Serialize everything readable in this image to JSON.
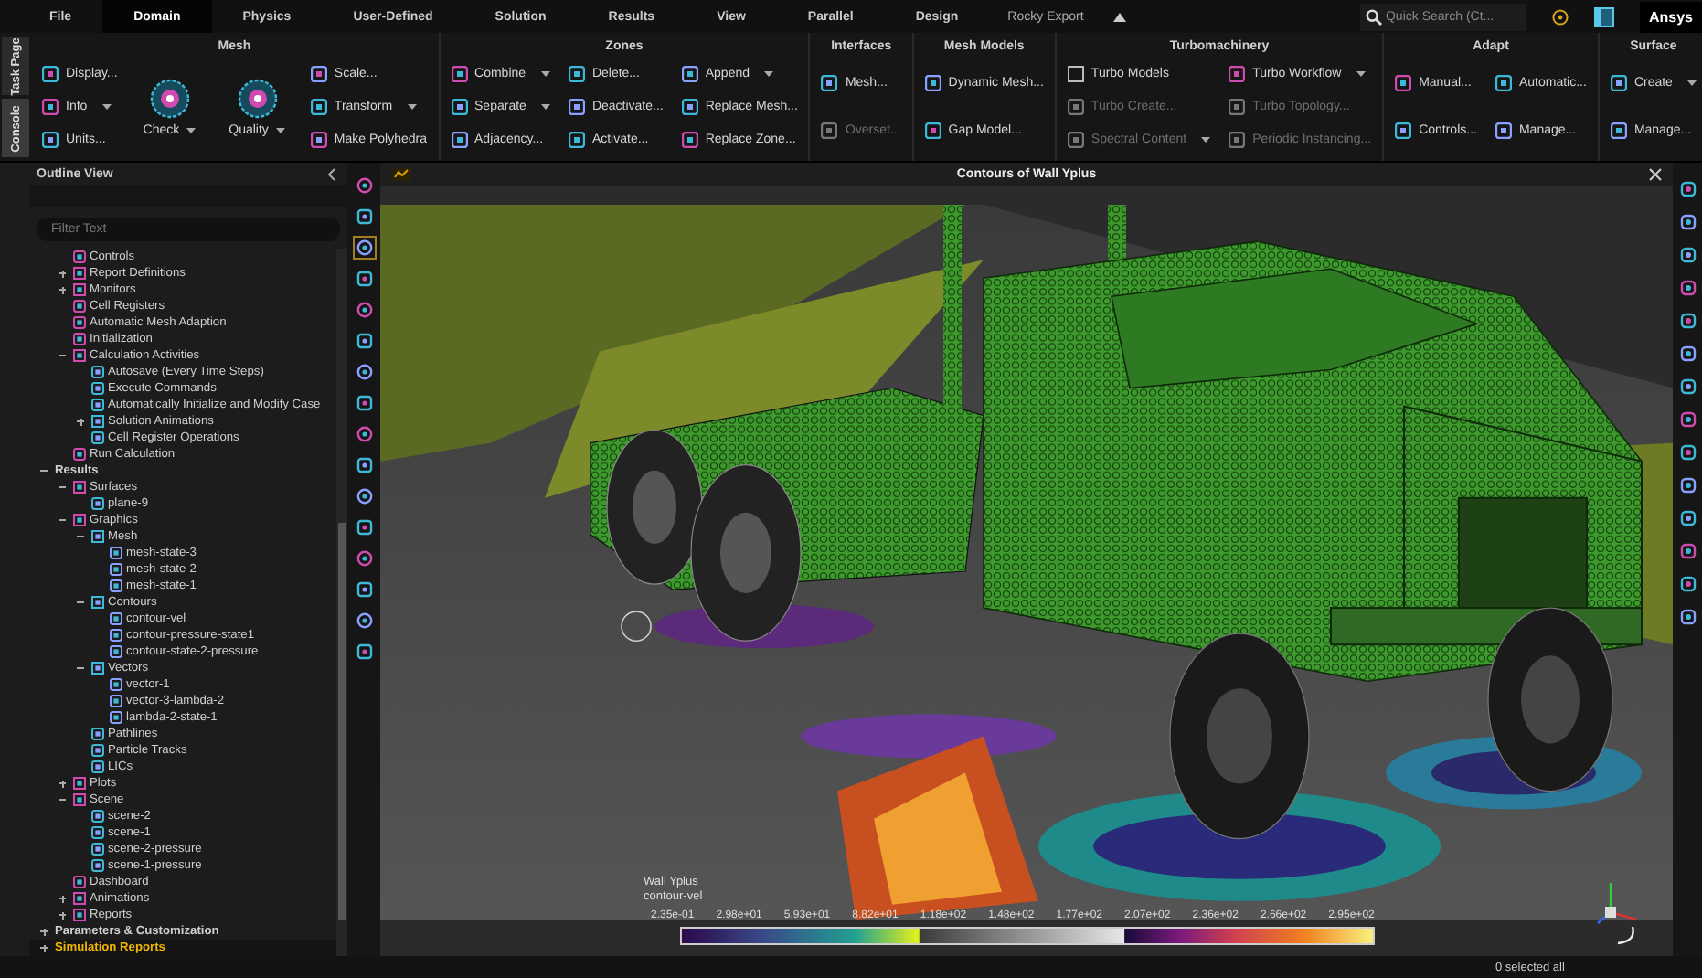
{
  "menu_tabs": [
    {
      "label": "File",
      "selected": false,
      "kind": "tab"
    },
    {
      "label": "Domain",
      "selected": true,
      "kind": "tab"
    },
    {
      "label": "Physics",
      "selected": false,
      "kind": "tab"
    },
    {
      "label": "User-Defined",
      "selected": false,
      "kind": "tab"
    },
    {
      "label": "Solution",
      "selected": false,
      "kind": "tab"
    },
    {
      "label": "Results",
      "selected": false,
      "kind": "tab"
    },
    {
      "label": "View",
      "selected": false,
      "kind": "tab"
    },
    {
      "label": "Parallel",
      "selected": false,
      "kind": "tab"
    },
    {
      "label": "Design",
      "selected": false,
      "kind": "tab"
    },
    {
      "label": "Rocky Export",
      "selected": false,
      "kind": "context"
    }
  ],
  "quick_search": {
    "placeholder": "Quick Search (Ct..."
  },
  "logo": "Ansys",
  "side_tabs": [
    {
      "label": "Task Page",
      "selected": false
    },
    {
      "label": "Console",
      "selected": true
    }
  ],
  "ribbon": {
    "groups": [
      {
        "title": "Mesh",
        "columns": [
          [
            {
              "label": "Display...",
              "kind": "small"
            },
            {
              "label": "Info",
              "kind": "small",
              "dropdown": true
            },
            {
              "label": "Units...",
              "kind": "small"
            }
          ],
          [
            {
              "label": "Check",
              "kind": "large",
              "dropdown": true
            }
          ],
          [
            {
              "label": "Quality",
              "kind": "large",
              "dropdown": true
            }
          ],
          [
            {
              "label": "Scale...",
              "kind": "small"
            },
            {
              "label": "Transform",
              "kind": "small",
              "dropdown": true
            },
            {
              "label": "Make Polyhedra",
              "kind": "small"
            }
          ]
        ]
      },
      {
        "title": "Zones",
        "columns": [
          [
            {
              "label": "Combine",
              "kind": "small",
              "dropdown": true
            },
            {
              "label": "Separate",
              "kind": "small",
              "dropdown": true
            },
            {
              "label": "Adjacency...",
              "kind": "small"
            }
          ],
          [
            {
              "label": "Delete...",
              "kind": "small"
            },
            {
              "label": "Deactivate...",
              "kind": "small"
            },
            {
              "label": "Activate...",
              "kind": "small"
            }
          ],
          [
            {
              "label": "Append",
              "kind": "small",
              "dropdown": true
            },
            {
              "label": "Replace Mesh...",
              "kind": "small"
            },
            {
              "label": "Replace Zone...",
              "kind": "small"
            }
          ]
        ]
      },
      {
        "title": "Interfaces",
        "columns": [
          [
            {
              "label": "Mesh...",
              "kind": "small"
            },
            {
              "label": "Overset...",
              "kind": "small",
              "disabled": true
            }
          ]
        ]
      },
      {
        "title": "Mesh Models",
        "columns": [
          [
            {
              "label": "Dynamic Mesh...",
              "kind": "small"
            },
            {
              "label": "Gap Model...",
              "kind": "small"
            }
          ]
        ]
      },
      {
        "title": "Turbomachinery",
        "columns": [
          [
            {
              "label": "Turbo Models",
              "kind": "checkbox",
              "checked": false
            },
            {
              "label": "Turbo Create...",
              "kind": "small",
              "disabled": true
            },
            {
              "label": "Spectral Content",
              "kind": "small",
              "disabled": true,
              "dropdown": true
            }
          ],
          [
            {
              "label": "Turbo Workflow",
              "kind": "small",
              "dropdown": true
            },
            {
              "label": "Turbo Topology...",
              "kind": "small",
              "disabled": true
            },
            {
              "label": "Periodic Instancing...",
              "kind": "small",
              "disabled": true
            }
          ]
        ]
      },
      {
        "title": "Adapt",
        "columns": [
          [
            {
              "label": "Manual...",
              "kind": "small"
            },
            {
              "label": "Controls...",
              "kind": "small"
            }
          ],
          [
            {
              "label": "Automatic...",
              "kind": "small"
            },
            {
              "label": "Manage...",
              "kind": "small"
            }
          ]
        ]
      },
      {
        "title": "Surface",
        "columns": [
          [
            {
              "label": "Create",
              "kind": "small",
              "dropdown": true
            },
            {
              "label": "Manage...",
              "kind": "small"
            }
          ]
        ]
      }
    ]
  },
  "outline": {
    "title": "Outline View",
    "filter": {
      "placeholder": "Filter Text"
    },
    "continued_items": [
      {
        "label": "Controls",
        "kind": "leaf",
        "selected": false
      },
      {
        "label": "Report Definitions",
        "kind": "folder",
        "expanded": false,
        "selected": false
      },
      {
        "label": "Monitors",
        "kind": "folder",
        "expanded": false,
        "selected": false
      },
      {
        "label": "Cell Registers",
        "kind": "leaf",
        "selected": false
      },
      {
        "label": "Automatic Mesh Adaption",
        "kind": "leaf",
        "selected": false
      },
      {
        "label": "Initialization",
        "kind": "leaf",
        "selected": false
      },
      {
        "label": "Calculation Activities",
        "kind": "folder",
        "expanded": true,
        "selected": false,
        "children": [
          {
            "label": "Autosave (Every Time Steps)",
            "kind": "leaf",
            "selected": false
          },
          {
            "label": "Execute Commands",
            "kind": "leaf",
            "selected": false
          },
          {
            "label": "Automatically Initialize and Modify Case",
            "kind": "leaf",
            "selected": false
          },
          {
            "label": "Solution Animations",
            "kind": "folder",
            "expanded": false,
            "selected": false
          },
          {
            "label": "Cell Register Operations",
            "kind": "leaf",
            "selected": false
          }
        ]
      },
      {
        "label": "Run Calculation",
        "kind": "leaf",
        "selected": false
      }
    ],
    "sections": [
      {
        "label": "Results",
        "kind": "folder",
        "expanded": true,
        "selected": false,
        "children": [
          {
            "label": "Surfaces",
            "kind": "folder",
            "expanded": true,
            "selected": false,
            "children": [
              {
                "label": "plane-9",
                "kind": "leaf",
                "selected": false
              }
            ]
          },
          {
            "label": "Graphics",
            "kind": "folder",
            "expanded": true,
            "selected": false,
            "children": [
              {
                "label": "Mesh",
                "kind": "folder",
                "expanded": true,
                "selected": false,
                "children": [
                  {
                    "label": "mesh-state-3",
                    "kind": "leaf",
                    "selected": false
                  },
                  {
                    "label": "mesh-state-2",
                    "kind": "leaf",
                    "selected": false
                  },
                  {
                    "label": "mesh-state-1",
                    "kind": "leaf",
                    "selected": false
                  }
                ]
              },
              {
                "label": "Contours",
                "kind": "folder",
                "expanded": true,
                "selected": false,
                "children": [
                  {
                    "label": "contour-vel",
                    "kind": "leaf",
                    "selected": false
                  },
                  {
                    "label": "contour-pressure-state1",
                    "kind": "leaf",
                    "selected": false
                  },
                  {
                    "label": "contour-state-2-pressure",
                    "kind": "leaf",
                    "selected": false
                  }
                ]
              },
              {
                "label": "Vectors",
                "kind": "folder",
                "expanded": true,
                "selected": false,
                "children": [
                  {
                    "label": "vector-1",
                    "kind": "leaf",
                    "selected": false
                  },
                  {
                    "label": "vector-3-lambda-2",
                    "kind": "leaf",
                    "selected": false
                  },
                  {
                    "label": "lambda-2-state-1",
                    "kind": "leaf",
                    "selected": false
                  }
                ]
              },
              {
                "label": "Pathlines",
                "kind": "leaf",
                "selected": false
              },
              {
                "label": "Particle Tracks",
                "kind": "leaf",
                "selected": false
              },
              {
                "label": "LICs",
                "kind": "leaf",
                "selected": false
              }
            ]
          },
          {
            "label": "Plots",
            "kind": "folder",
            "expanded": false,
            "selected": false
          },
          {
            "label": "Scene",
            "kind": "folder",
            "expanded": true,
            "selected": false,
            "children": [
              {
                "label": "scene-2",
                "kind": "leaf",
                "selected": false
              },
              {
                "label": "scene-1",
                "kind": "leaf",
                "selected": false
              },
              {
                "label": "scene-2-pressure",
                "kind": "leaf",
                "selected": false
              },
              {
                "label": "scene-1-pressure",
                "kind": "leaf",
                "selected": false
              }
            ]
          },
          {
            "label": "Dashboard",
            "kind": "leaf",
            "selected": false
          },
          {
            "label": "Animations",
            "kind": "folder",
            "expanded": false,
            "selected": false
          },
          {
            "label": "Reports",
            "kind": "folder",
            "expanded": false,
            "selected": false
          }
        ]
      },
      {
        "label": "Parameters & Customization",
        "kind": "folder",
        "expanded": false,
        "selected": false
      },
      {
        "label": "Simulation Reports",
        "kind": "folder",
        "expanded": false,
        "selected": true
      }
    ]
  },
  "viewport": {
    "title": "Contours of Wall Yplus",
    "colorbar": {
      "title": "Wall Yplus",
      "subtitle": "contour-vel",
      "labels": [
        "2.35e-01",
        "2.98e+01",
        "5.93e+01",
        "8.82e+01",
        "1.18e+02",
        "1.48e+02",
        "1.77e+02",
        "2.07e+02",
        "2.36e+02",
        "2.66e+02",
        "2.95e+02"
      ]
    }
  },
  "status_bar": {
    "selection": "0 selected all"
  }
}
